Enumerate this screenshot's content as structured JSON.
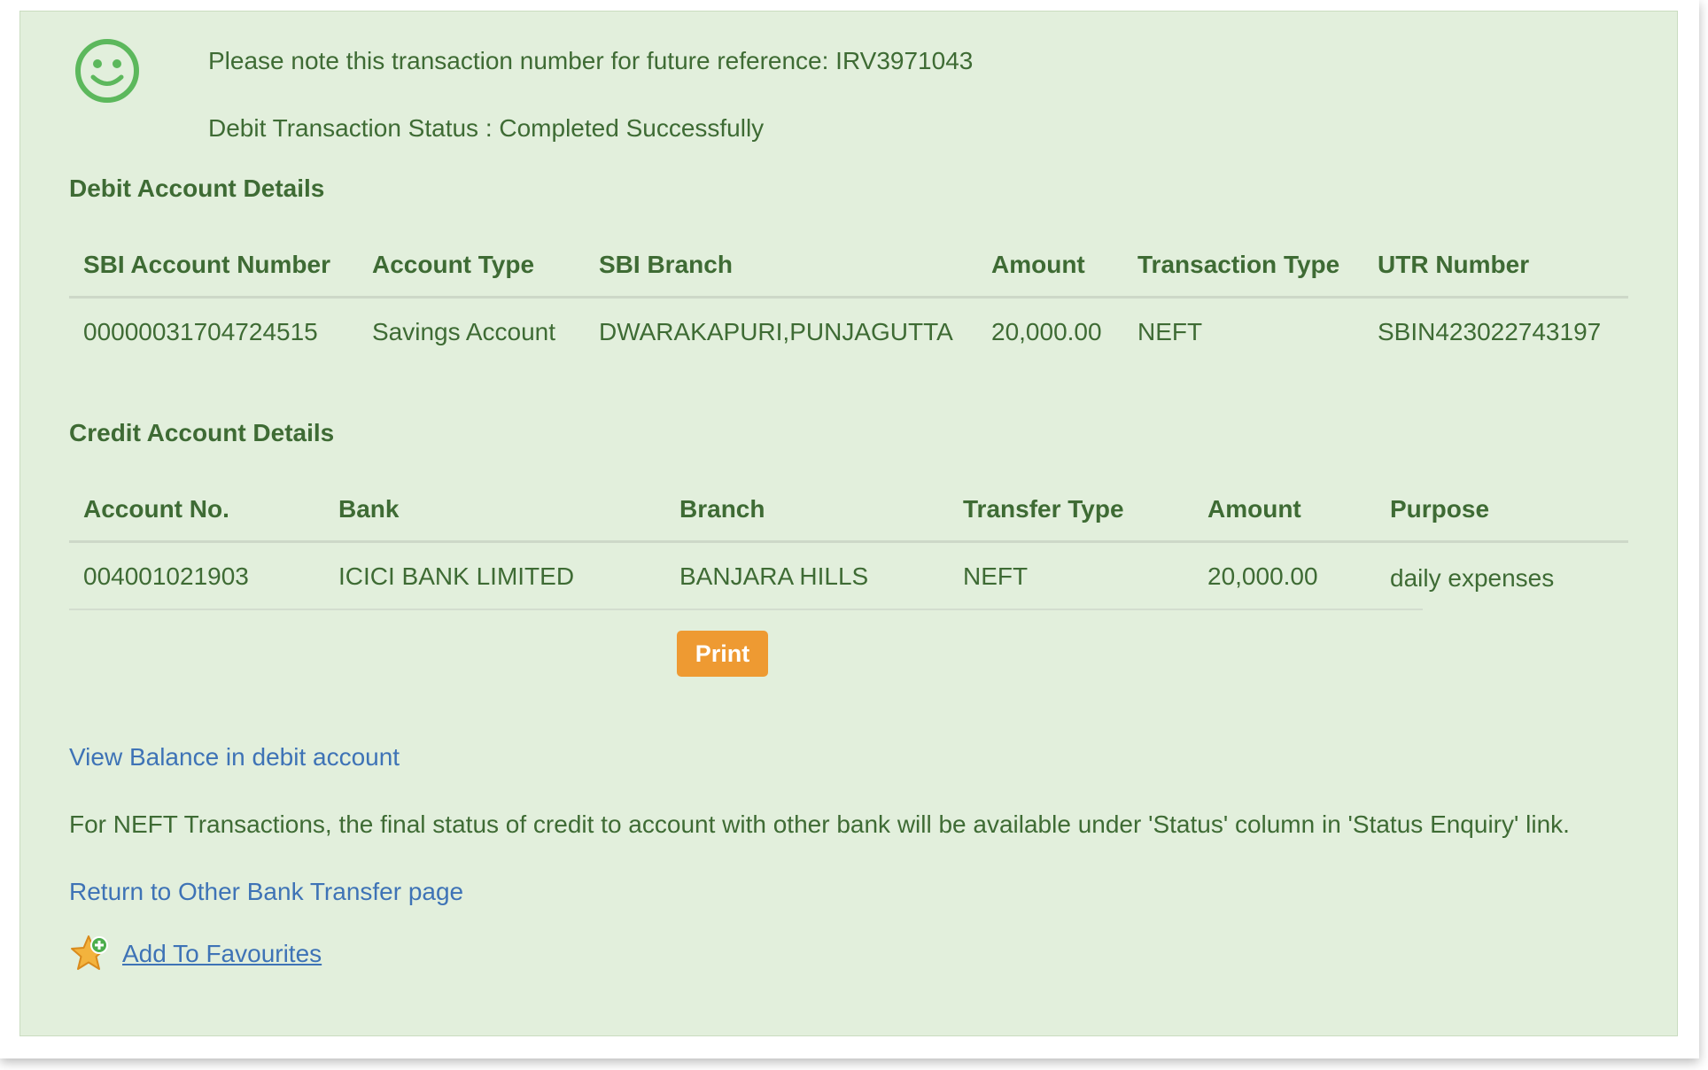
{
  "confirmation": {
    "reference_text": "Please note this transaction number for future reference: IRV3971043",
    "status_text": "Debit Transaction Status : Completed Successfully"
  },
  "debit": {
    "title": "Debit Account Details",
    "headers": {
      "account_number": "SBI Account Number",
      "account_type": "Account Type",
      "branch": "SBI Branch",
      "amount": "Amount",
      "transaction_type": "Transaction Type",
      "utr": "UTR Number"
    },
    "row": {
      "account_number": "00000031704724515",
      "account_type": "Savings Account",
      "branch": "DWARAKAPURI,PUNJAGUTTA",
      "amount": "20,000.00",
      "transaction_type": "NEFT",
      "utr": "SBIN423022743197"
    }
  },
  "credit": {
    "title": "Credit Account Details",
    "headers": {
      "account_no": "Account No.",
      "bank": "Bank",
      "branch": "Branch",
      "transfer_type": "Transfer Type",
      "amount": "Amount",
      "purpose": "Purpose"
    },
    "row": {
      "account_no": "004001021903",
      "bank": "ICICI BANK LIMITED",
      "branch": "BANJARA HILLS",
      "transfer_type": "NEFT",
      "amount": "20,000.00",
      "purpose": "daily expenses"
    }
  },
  "actions": {
    "print_label": "Print",
    "view_balance_link": "View Balance in debit account",
    "neft_note": "For NEFT Transactions, the final status of credit to account with other bank will be available under 'Status' column in 'Status Enquiry' link.",
    "return_link": "Return to Other Bank Transfer page",
    "add_favourites_label": "Add To Favourites"
  },
  "icons": {
    "status": "smiley-icon",
    "favourite": "star-add-icon"
  },
  "colors": {
    "panel_background": "#e2efdc",
    "text_green": "#3e6b34",
    "link_blue": "#3e73b6",
    "print_button": "#ee9a32",
    "smiley_green": "#5cb85c"
  }
}
